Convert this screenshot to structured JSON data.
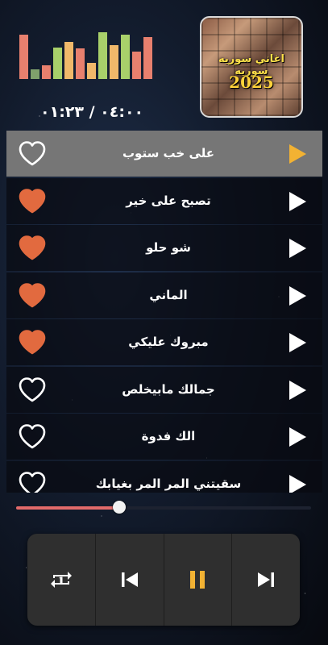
{
  "player": {
    "time_display": "٠٤:٠٠ / ٠١:٢٣",
    "progress_fraction": 0.35,
    "accent_color": "#e26a6a"
  },
  "album": {
    "title": "اغاني سوريه سوريه",
    "year": "2025"
  },
  "visualizer": {
    "levels": [
      0.95,
      0.2,
      0.3,
      0.68,
      0.8,
      0.65,
      0.35,
      1.0,
      0.72,
      0.95,
      0.58,
      0.9
    ],
    "colors": [
      "#e8806e",
      "#7fa06c",
      "#e8806e",
      "#a8d06a",
      "#f0b86a",
      "#e8806e",
      "#f0b86a",
      "#a8d06a",
      "#f0b86a",
      "#a8d06a",
      "#e8806e",
      "#e8806e"
    ]
  },
  "songs": [
    {
      "title": "على خب ستوب",
      "liked": false,
      "active": true
    },
    {
      "title": "تصبح على خير",
      "liked": true,
      "active": false
    },
    {
      "title": "شو حلو",
      "liked": true,
      "active": false
    },
    {
      "title": "الماني",
      "liked": true,
      "active": false
    },
    {
      "title": "مبروك عليكي",
      "liked": true,
      "active": false
    },
    {
      "title": "جمالك مابيخلص",
      "liked": false,
      "active": false
    },
    {
      "title": "الك فدوة",
      "liked": false,
      "active": false
    },
    {
      "title": "سقيتني المر المر بغيابك",
      "liked": false,
      "active": false
    }
  ],
  "colors": {
    "heart_liked": "#e26a3f",
    "play_active": "#f2b233",
    "pause": "#f2b233"
  },
  "controls": {
    "icons": [
      "repeat-one-icon",
      "skip-previous-icon",
      "pause-icon",
      "skip-next-icon"
    ]
  }
}
